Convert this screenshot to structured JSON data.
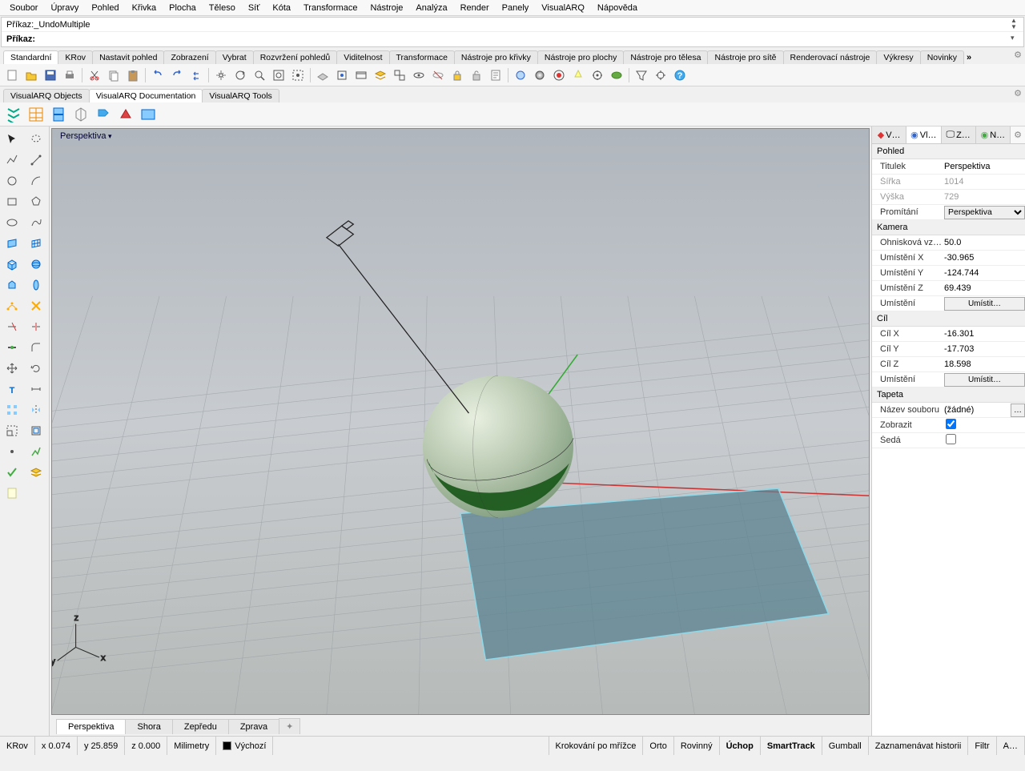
{
  "menu": [
    "Soubor",
    "Úpravy",
    "Pohled",
    "Křivka",
    "Plocha",
    "Těleso",
    "Síť",
    "Kóta",
    "Transformace",
    "Nástroje",
    "Analýza",
    "Render",
    "Panely",
    "VisualARQ",
    "Nápověda"
  ],
  "cmd": {
    "history_label": "Příkaz: ",
    "history_value": "_UndoMultiple",
    "prompt_label": "Příkaz: "
  },
  "tool_tabs": [
    "Standardní",
    "KRov",
    "Nastavit pohled",
    "Zobrazení",
    "Vybrat",
    "Rozvržení pohledů",
    "Viditelnost",
    "Transformace",
    "Nástroje pro křivky",
    "Nástroje pro plochy",
    "Nástroje pro tělesa",
    "Nástroje pro sítě",
    "Renderovací nástroje",
    "Výkresy",
    "Novinky"
  ],
  "va_tabs": [
    "VisualARQ Objects",
    "VisualARQ Documentation",
    "VisualARQ Tools"
  ],
  "viewport": {
    "label": "Perspektiva"
  },
  "vp_tabs": [
    "Perspektiva",
    "Shora",
    "Zepředu",
    "Zprava"
  ],
  "panel": {
    "tabs": [
      "V…",
      "Vl…",
      "Z…",
      "N…"
    ],
    "sections": {
      "pohled": {
        "title": "Pohled",
        "rows": [
          {
            "k": "Titulek",
            "v": "Perspektiva"
          },
          {
            "k": "Šířka",
            "v": "1014",
            "dim": true
          },
          {
            "k": "Výška",
            "v": "729",
            "dim": true
          },
          {
            "k": "Promítání",
            "v": "Perspektiva",
            "select": true
          }
        ]
      },
      "kamera": {
        "title": "Kamera",
        "rows": [
          {
            "k": "Ohnisková vz…",
            "v": "50.0"
          },
          {
            "k": "Umístění X",
            "v": "-30.965"
          },
          {
            "k": "Umístění Y",
            "v": "-124.744"
          },
          {
            "k": "Umístění Z",
            "v": "69.439"
          },
          {
            "k": "Umístění",
            "btn": "Umístit…"
          }
        ]
      },
      "cil": {
        "title": "Cíl",
        "rows": [
          {
            "k": "Cíl X",
            "v": "-16.301"
          },
          {
            "k": "Cíl Y",
            "v": "-17.703"
          },
          {
            "k": "Cíl Z",
            "v": "18.598"
          },
          {
            "k": "Umístění",
            "btn": "Umístit…"
          }
        ]
      },
      "tapeta": {
        "title": "Tapeta",
        "rows": [
          {
            "k": "Název souboru",
            "v": "(žádné)",
            "file": true
          },
          {
            "k": "Zobrazit",
            "check": true
          },
          {
            "k": "Šedá",
            "check": false
          }
        ]
      }
    }
  },
  "status": {
    "layer": "KRov",
    "x": "x 0.074",
    "y": "y 25.859",
    "z": "z 0.000",
    "units": "Milimetry",
    "current_layer": "Výchozí",
    "toggles": [
      "Krokování po mřížce",
      "Orto",
      "Rovinný",
      "Úchop",
      "SmartTrack",
      "Gumball",
      "Zaznamenávat historii",
      "Filtr",
      "A…"
    ],
    "toggles_bold": [
      "Úchop",
      "SmartTrack"
    ]
  }
}
